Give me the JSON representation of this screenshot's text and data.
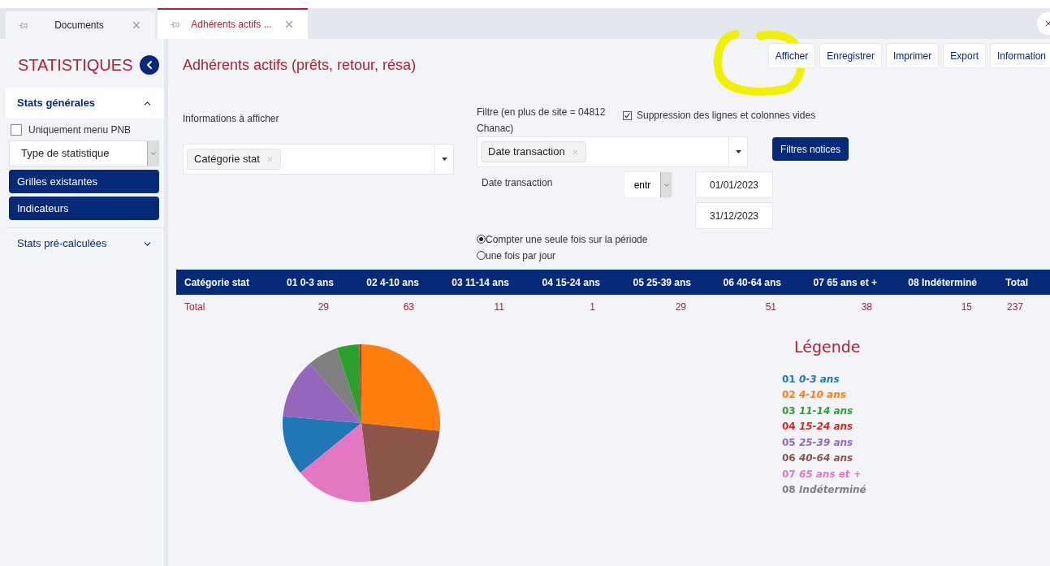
{
  "tabs": [
    {
      "label": "Documents",
      "selected": false
    },
    {
      "label": "Adhérents actifs ...",
      "selected": true
    }
  ],
  "sidebar": {
    "title": "STATISTIQUES",
    "sections": [
      {
        "label": "Stats générales",
        "expanded": true
      },
      {
        "label": "Stats pré-calculées",
        "expanded": false
      }
    ],
    "checkbox": {
      "label": "Uniquement menu PNB",
      "checked": false
    },
    "select": {
      "value": "Type de statistique"
    },
    "buttons": [
      "Grilles existantes",
      "Indicateurs"
    ]
  },
  "page_title": "Adhérents actifs (prêts, retour, résa)",
  "toolbar": [
    "Afficher",
    "Enregistrer",
    "Imprimer",
    "Export",
    "Information"
  ],
  "info_field": {
    "label": "Informations à afficher",
    "tags": [
      "Catégorie stat"
    ]
  },
  "filter_field": {
    "label": "Filtre (en plus de site = 04812 Chanac)",
    "tags": [
      "Date transaction"
    ]
  },
  "suppress": {
    "label": "Suppression des lignes et colonnes vides",
    "checked": true
  },
  "filter_button": "Filtres notices",
  "date_filter": {
    "label": "Date transaction",
    "operator": "entr",
    "from": "01/01/2023",
    "to": "31/12/2023"
  },
  "count_mode": [
    {
      "label": "Compter une seule fois sur la période",
      "selected": true
    },
    {
      "label": "une fois par jour",
      "selected": false
    }
  ],
  "table": {
    "columns": [
      "Catégorie stat",
      "01 0-3 ans",
      "02 4-10 ans",
      "03 11-14 ans",
      "04 15-24 ans",
      "05 25-39 ans",
      "06 40-64 ans",
      "07 65 ans et +",
      "08 Indéterminé",
      "Total"
    ],
    "rows": [
      [
        "Total",
        "29",
        "63",
        "11",
        "1",
        "29",
        "51",
        "38",
        "15",
        "237"
      ]
    ]
  },
  "chart_data": {
    "type": "pie",
    "categories": [
      "01 0-3 ans",
      "02 4-10 ans",
      "03 11-14 ans",
      "04 15-24 ans",
      "05 25-39 ans",
      "06 40-64 ans",
      "07 65 ans et +",
      "08 Indéterminé"
    ],
    "values": [
      29,
      63,
      11,
      1,
      29,
      51,
      38,
      15
    ]
  },
  "legend": {
    "title": "Légende",
    "items": [
      {
        "color": "#1f77b4"
      },
      {
        "color": "#ff7f0e"
      },
      {
        "color": "#2ca02c"
      },
      {
        "color": "#d62728"
      },
      {
        "color": "#9467bd"
      },
      {
        "color": "#8c564b"
      },
      {
        "color": "#e377c2"
      },
      {
        "color": "#7f7f7f"
      }
    ]
  }
}
